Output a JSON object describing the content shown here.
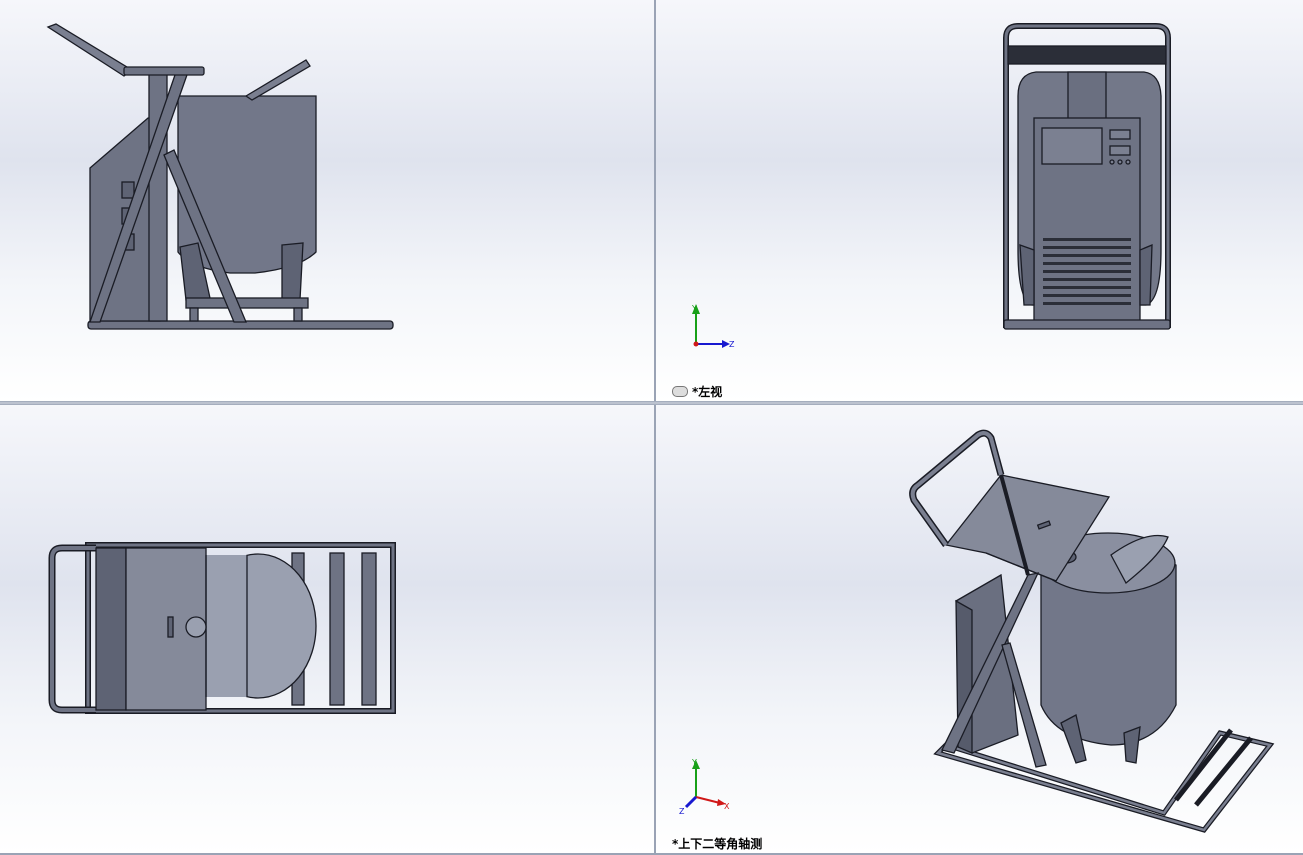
{
  "views": {
    "top_left": {
      "label": ""
    },
    "top_right": {
      "label": "*左视",
      "axes": {
        "y": "Y",
        "z": "Z"
      }
    },
    "bottom_left": {
      "label": ""
    },
    "bottom_right": {
      "label": "*上下二等角轴测",
      "axes": {
        "y": "Y",
        "x": "X",
        "z": "Z"
      }
    }
  },
  "colors": {
    "model_fill": "#6e7384",
    "model_light": "#9aa0b0",
    "edge": "#1a1c25",
    "axis_x": "#d01818",
    "axis_y": "#18a018",
    "axis_z": "#1818d0"
  },
  "icons": {
    "link": "link-icon"
  }
}
